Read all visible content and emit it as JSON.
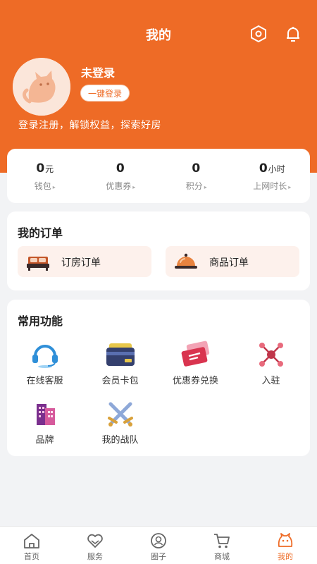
{
  "header": {
    "title": "我的",
    "icons": [
      "settings-icon",
      "bell-icon"
    ],
    "color": "#ee6b26"
  },
  "profile": {
    "username": "未登录",
    "login_button": "一键登录",
    "slogan": "登录注册，解锁权益，探索好房"
  },
  "stats": [
    {
      "value": "0",
      "unit": "元",
      "label": "钱包"
    },
    {
      "value": "0",
      "unit": "",
      "label": "优惠券"
    },
    {
      "value": "0",
      "unit": "",
      "label": "积分"
    },
    {
      "value": "0",
      "unit": "小时",
      "label": "上网时长"
    }
  ],
  "orders": {
    "title": "我的订单",
    "items": [
      {
        "label": "订房订单",
        "icon": "bed-icon"
      },
      {
        "label": "商品订单",
        "icon": "food-cloche-icon"
      }
    ]
  },
  "features": {
    "title": "常用功能",
    "items": [
      {
        "label": "在线客服",
        "icon": "headset-icon"
      },
      {
        "label": "会员卡包",
        "icon": "card-wallet-icon"
      },
      {
        "label": "优惠券兑换",
        "icon": "coupon-icon"
      },
      {
        "label": "入驻",
        "icon": "network-icon"
      },
      {
        "label": "品牌",
        "icon": "building-icon"
      },
      {
        "label": "我的战队",
        "icon": "crossed-swords-icon"
      }
    ]
  },
  "tabbar": {
    "items": [
      {
        "label": "首页",
        "icon": "home-icon"
      },
      {
        "label": "服务",
        "icon": "heart-hands-icon"
      },
      {
        "label": "圈子",
        "icon": "circle-profile-icon"
      },
      {
        "label": "商城",
        "icon": "cart-icon"
      },
      {
        "label": "我的",
        "icon": "cat-face-icon",
        "active": true
      }
    ]
  }
}
